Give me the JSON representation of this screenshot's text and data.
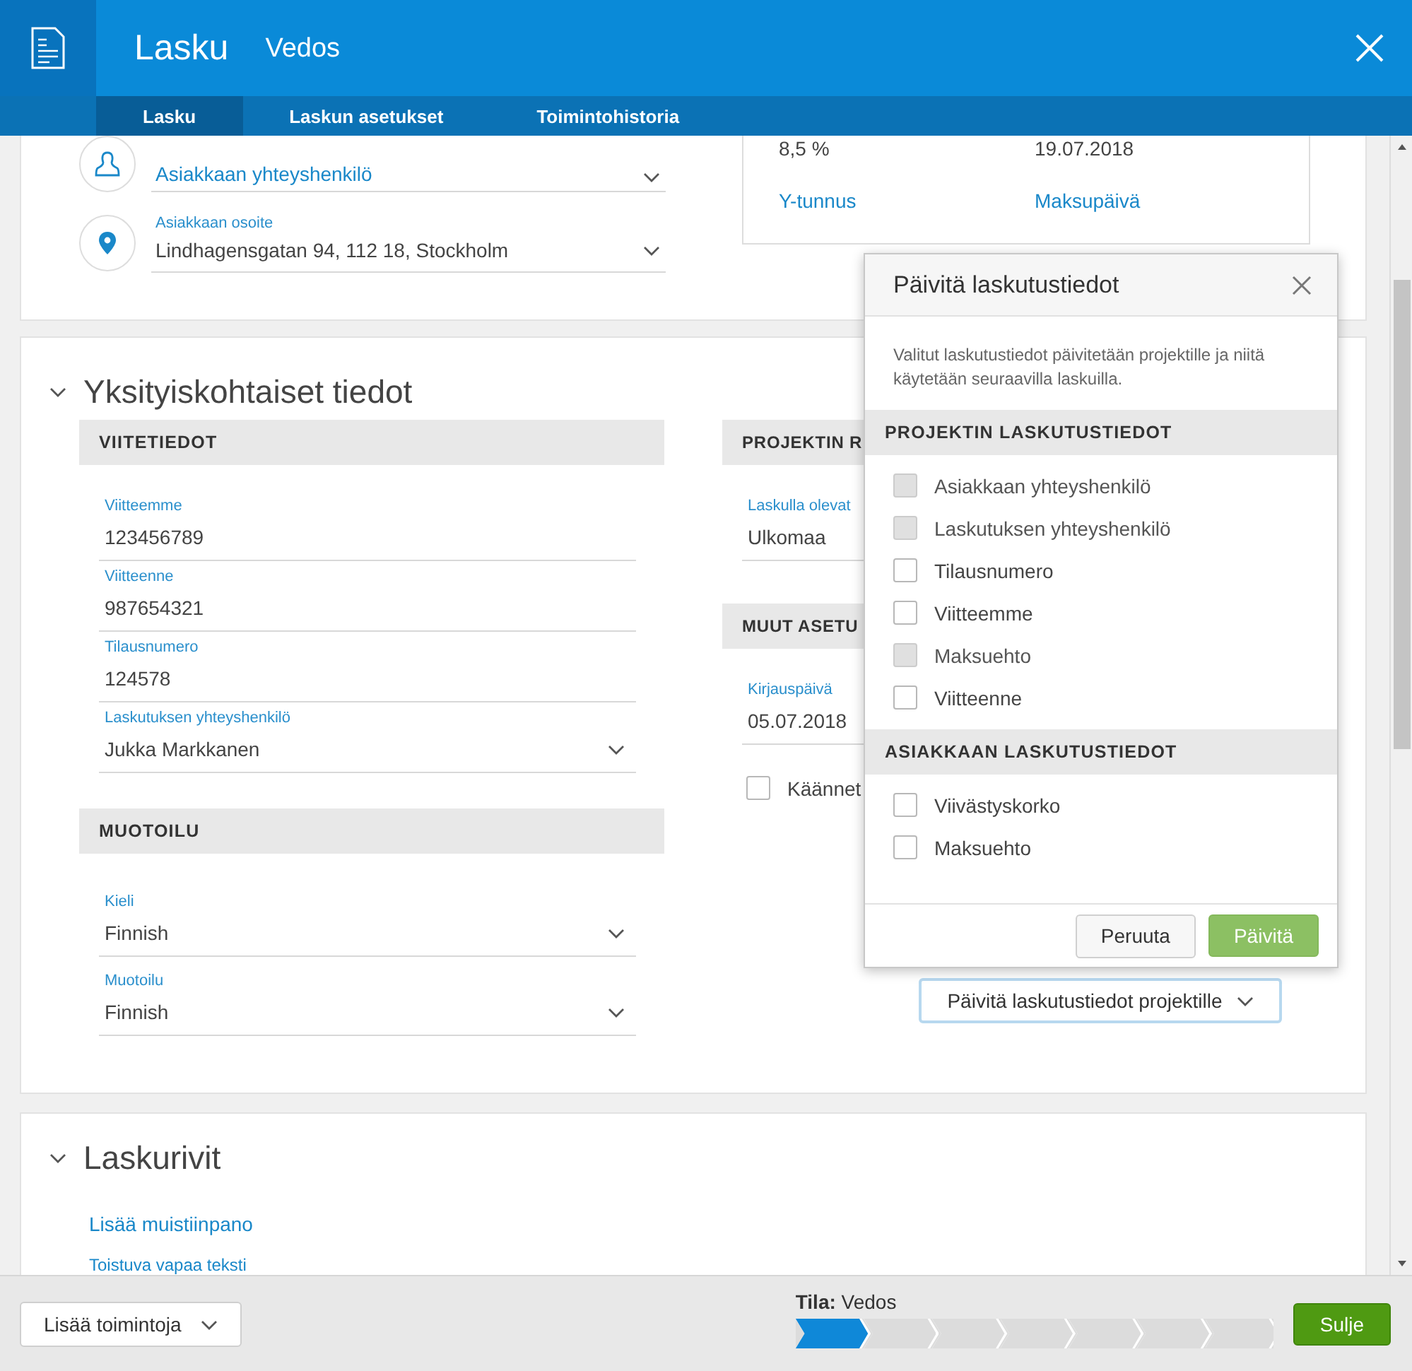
{
  "header": {
    "title": "Lasku",
    "subtitle": "Vedos"
  },
  "tabs": [
    {
      "label": "Lasku",
      "selected": true
    },
    {
      "label": "Laskun asetukset",
      "selected": false
    },
    {
      "label": "Toimintohistoria",
      "selected": false
    }
  ],
  "customer": {
    "contact": {
      "placeholder": "Asiakkaan yhteyshenkilö"
    },
    "address": {
      "label": "Asiakkaan osoite",
      "value": "Lindhagensgatan 94, 112 18, Stockholm"
    },
    "summary": {
      "values": [
        "8,5 %",
        "19.07.2018"
      ],
      "links": [
        "Y-tunnus",
        "Maksupäivä"
      ]
    }
  },
  "details": {
    "title": "Yksityiskohtaiset tiedot",
    "expanded": true,
    "references": {
      "heading": "VIITETIEDOT",
      "fields": [
        {
          "label": "Viitteemme",
          "value": "123456789",
          "kind": "text"
        },
        {
          "label": "Viitteenne",
          "value": "987654321",
          "kind": "text"
        },
        {
          "label": "Tilausnumero",
          "value": "124578",
          "kind": "text"
        },
        {
          "label": "Laskutuksen yhteyshenkilö",
          "value": "Jukka Markkanen",
          "kind": "select"
        }
      ]
    },
    "formatting": {
      "heading": "MUOTOILU",
      "fields": [
        {
          "label": "Kieli",
          "value": "Finnish",
          "kind": "select"
        },
        {
          "label": "Muotoilu",
          "value": "Finnish",
          "kind": "select"
        }
      ]
    },
    "project": {
      "heading": "PROJEKTIN R",
      "fields": [
        {
          "label": "Laskulla olevat",
          "value": "Ulkomaa"
        }
      ]
    },
    "other": {
      "heading": "MUUT ASETU",
      "fields": [
        {
          "label": "Kirjauspäivä",
          "value": "05.07.2018"
        }
      ],
      "checkbox": {
        "label": "Käännet",
        "checked": false
      }
    },
    "update_button": "Päivitä laskutustiedot projektille"
  },
  "invoice_rows": {
    "title": "Laskurivit",
    "expanded": true,
    "links": [
      "Lisää muistiinpano",
      "Toistuva vapaa teksti"
    ]
  },
  "footer": {
    "more_button": "Lisää toimintoja",
    "status_label": "Tila:",
    "status_value": "Vedos",
    "steps": [
      {
        "active": true
      },
      {
        "active": false
      },
      {
        "active": false
      },
      {
        "active": false
      },
      {
        "active": false
      },
      {
        "active": false
      },
      {
        "active": false
      }
    ],
    "close_button": "Sulje"
  },
  "dialog": {
    "title": "Päivitä laskutustiedot",
    "description": "Valitut laskutustiedot päivitetään projektille ja niitä käytetään seuraavilla laskuilla.",
    "groups": [
      {
        "heading": "PROJEKTIN LASKUTUSTIEDOT",
        "items": [
          {
            "label": "Asiakkaan yhteyshenkilö",
            "checked": false,
            "disabled": true
          },
          {
            "label": "Laskutuksen yhteyshenkilö",
            "checked": false,
            "disabled": true
          },
          {
            "label": "Tilausnumero",
            "checked": false,
            "disabled": false
          },
          {
            "label": "Viitteemme",
            "checked": false,
            "disabled": false
          },
          {
            "label": "Maksuehto",
            "checked": false,
            "disabled": true
          },
          {
            "label": "Viitteenne",
            "checked": false,
            "disabled": false
          }
        ]
      },
      {
        "heading": "ASIAKKAAN LASKUTUSTIEDOT",
        "items": [
          {
            "label": "Viivästyskorko",
            "checked": false,
            "disabled": false
          },
          {
            "label": "Maksuehto",
            "checked": false,
            "disabled": false
          }
        ]
      }
    ],
    "cancel": "Peruuta",
    "confirm": "Päivitä"
  }
}
